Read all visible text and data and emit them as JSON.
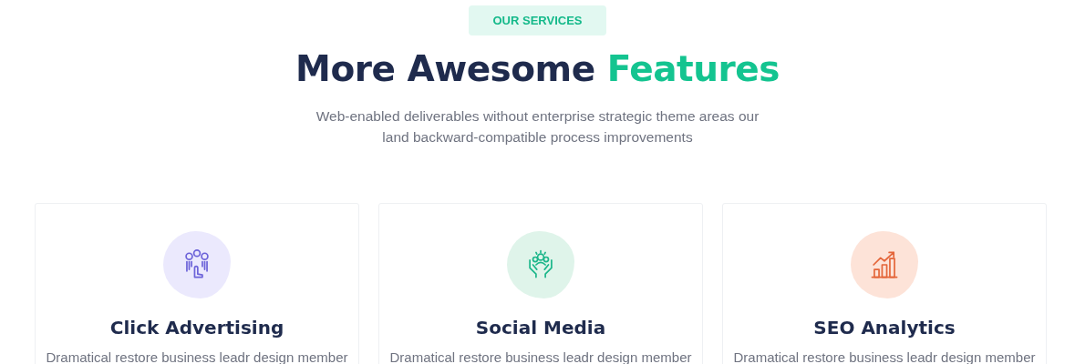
{
  "badge": "OUR SERVICES",
  "title": "More Awesome",
  "title_highlight": "Features",
  "subtitle": "Web-enabled deliverables without enterprise strategic theme areas our land backward-compatible process improvements",
  "cards": [
    {
      "kind": "advertising",
      "color": "#ebe9fd",
      "title": "Click Advertising",
      "text": "Dramatical restore business leadr design member"
    },
    {
      "kind": "social",
      "color": "#dff4ea",
      "title": "Social Media",
      "text": "Dramatical restore business leadr design member"
    },
    {
      "kind": "analytics",
      "color": "#fde3d8",
      "title": "SEO Analytics",
      "text": "Dramatical restore business leadr design member"
    }
  ]
}
